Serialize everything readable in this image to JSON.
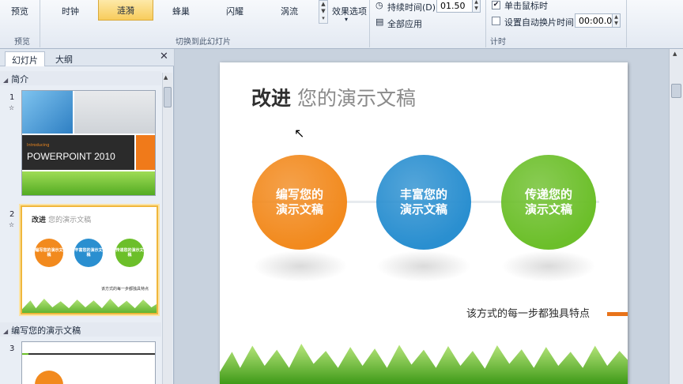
{
  "ribbon": {
    "preview_btn": "预览",
    "preview_group": "预览",
    "transitions": [
      {
        "label": "时钟",
        "selected": false
      },
      {
        "label": "涟漪",
        "selected": true
      },
      {
        "label": "蜂巢",
        "selected": false
      },
      {
        "label": "闪耀",
        "selected": false
      },
      {
        "label": "涡流",
        "selected": false
      }
    ],
    "effect_options": "效果选项",
    "transition_group": "切换到此幻灯片",
    "duration_label": "持续时间(D):",
    "duration_value": "01.50",
    "apply_all": "全部应用",
    "on_click_label": "单击鼠标时",
    "on_click_checked": true,
    "auto_after_label": "设置自动换片时间:",
    "auto_after_value": "00:00.00",
    "timing_group": "计时"
  },
  "panel": {
    "tab_slides": "幻灯片",
    "tab_outline": "大纲",
    "close": "✕",
    "sections": [
      "简介",
      "编写您的演示文稿"
    ],
    "slide_numbers": [
      "1",
      "2",
      "3"
    ],
    "thumb1_title": "POWERPOINT 2010",
    "thumb1_kicker": "Introducing",
    "thumb2_title_a": "改进",
    "thumb2_title_b": "您的演示文稿",
    "thumb2_circles": [
      "编写您的演示文稿",
      "丰富您的演示文稿",
      "传递您的演示文稿"
    ],
    "thumb2_caption": "该方式的每一步都独具特点"
  },
  "slide": {
    "title_a": "改进",
    "title_b": "您的演示文稿",
    "circles": [
      {
        "label": "编写您的\n演示文稿",
        "color": "#f28a1e"
      },
      {
        "label": "丰富您的\n演示文稿",
        "color": "#2a8fd0"
      },
      {
        "label": "传递您的\n演示文稿",
        "color": "#6cbf2a"
      }
    ],
    "caption": "该方式的每一步都独具特点",
    "accent": "#e8731a"
  }
}
